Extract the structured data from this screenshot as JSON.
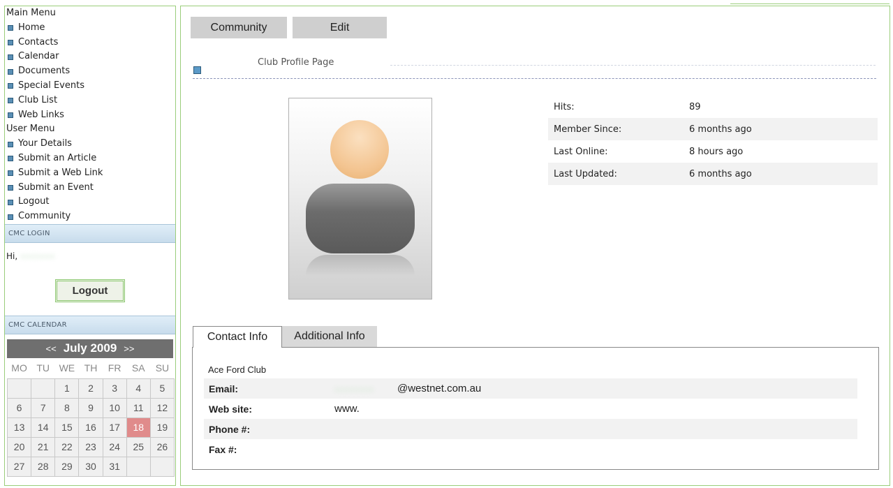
{
  "sidebar": {
    "main_menu_title": "Main Menu",
    "main_menu": [
      "Home",
      "Contacts",
      "Calendar",
      "Documents",
      "Special Events",
      "Club List",
      "Web Links"
    ],
    "user_menu_title": "User Menu",
    "user_menu": [
      "Your Details",
      "Submit an Article",
      "Submit a Web Link",
      "Submit an Event",
      "Logout",
      "Community"
    ],
    "login_title": "CMC LOGIN",
    "greeting": "Hi,",
    "logout_label": "Logout",
    "calendar_title": "CMC CALENDAR"
  },
  "calendar": {
    "prev": "<<",
    "month_year": "July 2009",
    "next": ">>",
    "weekdays": [
      "MO",
      "TU",
      "WE",
      "TH",
      "FR",
      "SA",
      "SU"
    ],
    "weeks": [
      [
        "",
        "",
        "1",
        "2",
        "3",
        "4",
        "5"
      ],
      [
        "6",
        "7",
        "8",
        "9",
        "10",
        "11",
        "12"
      ],
      [
        "13",
        "14",
        "15",
        "16",
        "17",
        "18",
        "19"
      ],
      [
        "20",
        "21",
        "22",
        "23",
        "24",
        "25",
        "26"
      ],
      [
        "27",
        "28",
        "29",
        "30",
        "31",
        "",
        ""
      ]
    ],
    "today": "18"
  },
  "main": {
    "buttons": {
      "community": "Community",
      "edit": "Edit"
    },
    "profile_title": "Club Profile Page",
    "stats": [
      {
        "label": "Hits:",
        "value": "89"
      },
      {
        "label": "Member Since:",
        "value": "6 months ago"
      },
      {
        "label": "Last Online:",
        "value": "8 hours ago"
      },
      {
        "label": "Last Updated:",
        "value": "6 months ago"
      }
    ],
    "tabs": {
      "contact": "Contact Info",
      "additional": "Additional Info"
    },
    "contact": {
      "club_name": "Ace Ford Club",
      "email_label": "Email:",
      "email_value": "@westnet.com.au",
      "website_label": "Web site:",
      "website_value": "www.",
      "phone_label": "Phone #:",
      "fax_label": "Fax #:"
    }
  },
  "colors": {
    "border_green": "#9acd7a",
    "calendar_today": "#e08b8b",
    "bullet_blue": "#5a8fb5"
  }
}
